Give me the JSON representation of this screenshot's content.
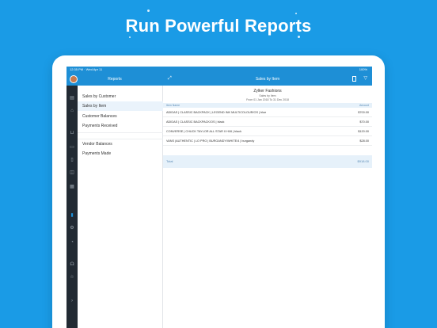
{
  "headline": "Run Powerful Reports",
  "status": {
    "time": "12:35 PM · Wed Apr 11",
    "battery": "100%"
  },
  "sidebar": {
    "title": "Reports",
    "items": [
      {
        "label": "Sales by Customer"
      },
      {
        "label": "Sales by Item"
      },
      {
        "label": "Customer Balances"
      },
      {
        "label": "Payments Received"
      },
      {
        "label": "Vendor Balances"
      },
      {
        "label": "Payments Made"
      }
    ]
  },
  "main": {
    "title": "Sales by Item",
    "org": "Zylker Fashions",
    "report_name": "Sales by Item",
    "period": "From 01 Jan 2018 To 31 Dec 2018",
    "columns": [
      "Item Name",
      "Amount"
    ],
    "rows": [
      {
        "name": "ADIDAS | CLASSIC BACKPACK | LEGEND INK MULTICOLOUR/OS | blue",
        "amount": "$700.00"
      },
      {
        "name": "ADIDAS | CLASSIC BACKPACK/OS | black",
        "amount": "$70.00"
      },
      {
        "name": "CONVERSE | CHUCK TAYLOR ALL STAR II HI/6 | black",
        "amount": "$120.00"
      },
      {
        "name": "VANS |AUTHENTIC | LO PRO | BURGANDY/WHITE/4 | burgandy",
        "amount": "$28.00"
      }
    ],
    "total_label": "Total",
    "total_amount": "$918.00"
  },
  "icons": {
    "rail": [
      "notes-icon",
      "home-icon",
      "cart-icon",
      "doc-icon",
      "invoice-icon",
      "bag-icon",
      "report-icon",
      "reports-chart-icon",
      "settings-icon",
      "bell-icon",
      "support-icon",
      "star-icon",
      "chevron-right-icon"
    ]
  },
  "colors": {
    "background": "#1a9be6",
    "accent": "#1e8fd6",
    "rail": "#222a33"
  }
}
